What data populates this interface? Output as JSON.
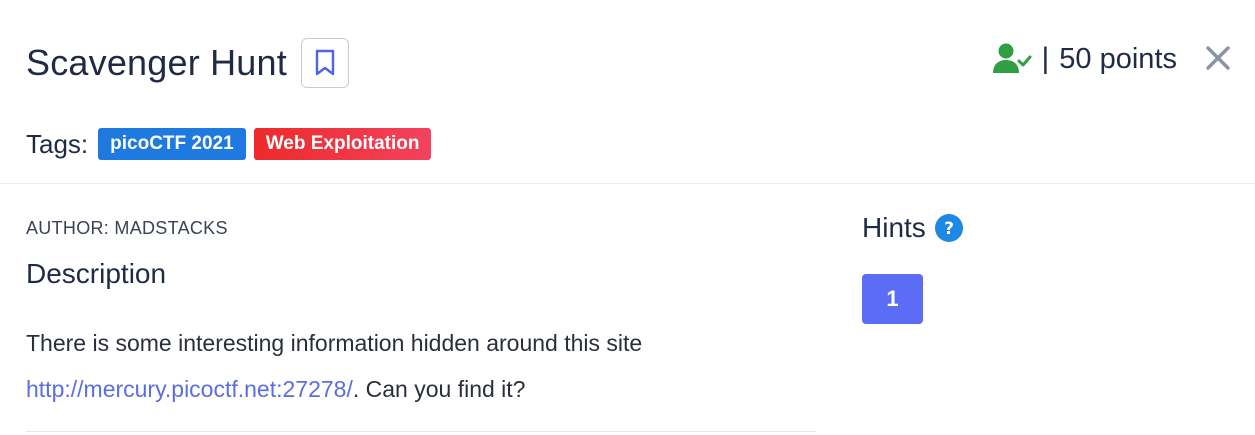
{
  "challenge": {
    "title": "Scavenger Hunt",
    "solved_separator": "|",
    "points": "50 points"
  },
  "tags": {
    "label": "Tags:",
    "items": [
      "picoCTF 2021",
      "Web Exploitation"
    ]
  },
  "details": {
    "author": "AUTHOR: MADSTACKS",
    "description_heading": "Description",
    "description_line1": "There is some interesting information hidden around this site",
    "link_text": "http://mercury.picoctf.net:27278/",
    "description_tail": ". Can you find it?"
  },
  "hints": {
    "title": "Hints",
    "buttons": [
      "1"
    ]
  },
  "colors": {
    "accent": "#5b6df5",
    "link": "#5b6ee1",
    "solved_green": "#2ea043",
    "tag_blue": "#1f7ae0",
    "tag_red": "#ee2a2a",
    "help_blue": "#1e88e5"
  },
  "icons": [
    "bookmark-icon",
    "user-check-icon",
    "close-icon",
    "help-icon"
  ]
}
